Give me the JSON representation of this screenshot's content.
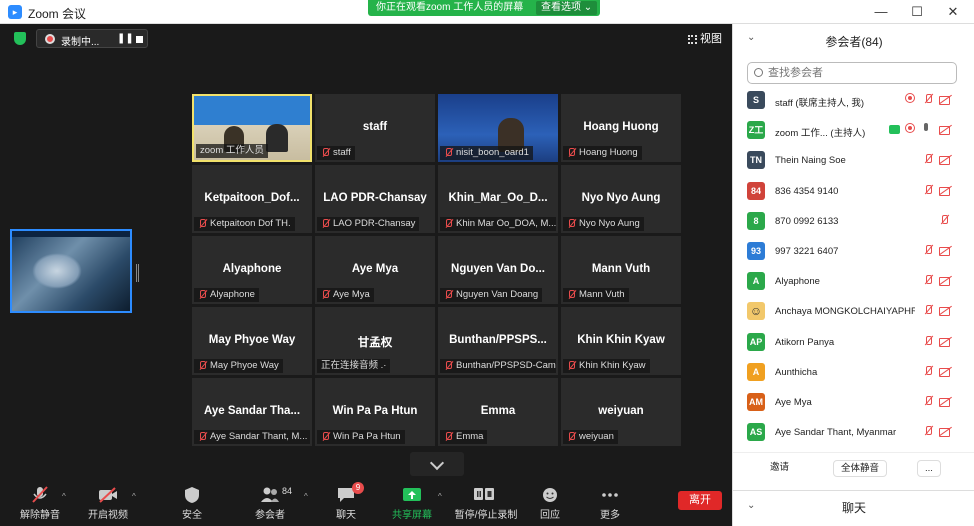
{
  "window": {
    "title": "Zoom 会议",
    "min": "—",
    "max": "☐",
    "close": "✕"
  },
  "share_banner": {
    "text": "你正在观看zoom 工作人员的屏幕",
    "options": "查看选项 ⌄"
  },
  "recording": {
    "label": "录制中...",
    "pause": "❚❚"
  },
  "view_button": "视图",
  "tiles": [
    {
      "name": "",
      "caption": "zoom 工作人员",
      "video": "vid1",
      "muted": false,
      "active": true
    },
    {
      "name": "staff",
      "caption": "staff",
      "muted": true
    },
    {
      "name": "",
      "caption": "nisit_boon_oard1",
      "video": "vid3",
      "muted": true
    },
    {
      "name": "Hoang Huong",
      "caption": "Hoang Huong",
      "muted": true
    },
    {
      "name": "Ketpaitoon_Dof...",
      "caption": "Ketpaitoon Dof TH.",
      "muted": true
    },
    {
      "name": "LAO PDR-Chansay",
      "caption": "LAO PDR-Chansay",
      "muted": true
    },
    {
      "name": "Khin_Mar_Oo_D...",
      "caption": "Khin Mar Oo_DOA, M...",
      "muted": true
    },
    {
      "name": "Nyo Nyo Aung",
      "caption": "Nyo Nyo Aung",
      "muted": true
    },
    {
      "name": "Alyaphone",
      "caption": "Alyaphone",
      "muted": true
    },
    {
      "name": "Aye Mya",
      "caption": "Aye Mya",
      "muted": true
    },
    {
      "name": "Nguyen Van Do...",
      "caption": "Nguyen Van Doang",
      "muted": true
    },
    {
      "name": "Mann Vuth",
      "caption": "Mann Vuth",
      "muted": true
    },
    {
      "name": "May Phyoe Way",
      "caption": "May Phyoe Way",
      "muted": true
    },
    {
      "name": "甘孟权",
      "caption": "正在连接音频 .·",
      "muted": false
    },
    {
      "name": "Bunthan/PPSPS...",
      "caption": "Bunthan/PPSPSD-Cam...",
      "muted": true
    },
    {
      "name": "Khin Khin Kyaw",
      "caption": "Khin Khin Kyaw",
      "muted": true
    },
    {
      "name": "Aye Sandar Tha...",
      "caption": "Aye Sandar Thant, M...",
      "muted": true
    },
    {
      "name": "Win Pa Pa Htun",
      "caption": "Win Pa Pa Htun",
      "muted": true
    },
    {
      "name": "Emma",
      "caption": "Emma",
      "muted": true
    },
    {
      "name": "weiyuan",
      "caption": "weiyuan",
      "muted": true
    }
  ],
  "toolbar": {
    "unmute": "解除静音",
    "start_video": "开启视频",
    "security": "安全",
    "participants": "参会者",
    "participants_count": "84",
    "chat": "聊天",
    "chat_badge": "9",
    "share": "共享屏幕",
    "record": "暂停/停止录制",
    "reactions": "回应",
    "more": "更多",
    "leave": "离开"
  },
  "panel": {
    "title": "参会者(84)",
    "search_placeholder": "查找参会者",
    "participants": [
      {
        "avatar": "S",
        "color": "#3a4a5c",
        "name": "staff (联席主持人, 我)",
        "icons": [
          "rec",
          "micoff",
          "camoff"
        ]
      },
      {
        "avatar": "Z工",
        "color": "#2ba84a",
        "name": "zoom 工作...   (主持人)",
        "icons": [
          "share",
          "rec",
          "micon",
          "camoff"
        ]
      },
      {
        "avatar": "TN",
        "color": "#3a4a5c",
        "name": "Thein Naing Soe",
        "icons": [
          "micoff",
          "camoff"
        ]
      },
      {
        "avatar": "84",
        "color": "#d0433a",
        "name": "836 4354 9140",
        "icons": [
          "micoff",
          "camoff"
        ]
      },
      {
        "avatar": "8",
        "color": "#2ba84a",
        "name": "870 0992 6133",
        "icons": [
          "micoff"
        ]
      },
      {
        "avatar": "93",
        "color": "#2d7cd6",
        "name": "997 3221 6407",
        "icons": [
          "micoff",
          "camoff"
        ]
      },
      {
        "avatar": "A",
        "color": "#2ba84a",
        "name": "Alyaphone",
        "icons": [
          "micoff",
          "camoff"
        ]
      },
      {
        "avatar": "☺",
        "color": "#f2c86b",
        "name": "Anchaya MONGKOLCHAIYAPHR...",
        "icons": [
          "micoff",
          "camoff"
        ]
      },
      {
        "avatar": "AP",
        "color": "#2ba84a",
        "name": "Atikorn Panya",
        "icons": [
          "micoff",
          "camoff"
        ]
      },
      {
        "avatar": "A",
        "color": "#f0a020",
        "name": "Aunthicha",
        "icons": [
          "micoff",
          "camoff"
        ]
      },
      {
        "avatar": "AM",
        "color": "#d86018",
        "name": "Aye Mya",
        "icons": [
          "micoff",
          "camoff"
        ]
      },
      {
        "avatar": "AS",
        "color": "#2ba84a",
        "name": "Aye Sandar Thant, Myanmar",
        "icons": [
          "micoff",
          "camoff"
        ]
      }
    ],
    "invite": "邀请",
    "mute_all": "全体静音",
    "more": "...",
    "chat_title": "聊天"
  }
}
